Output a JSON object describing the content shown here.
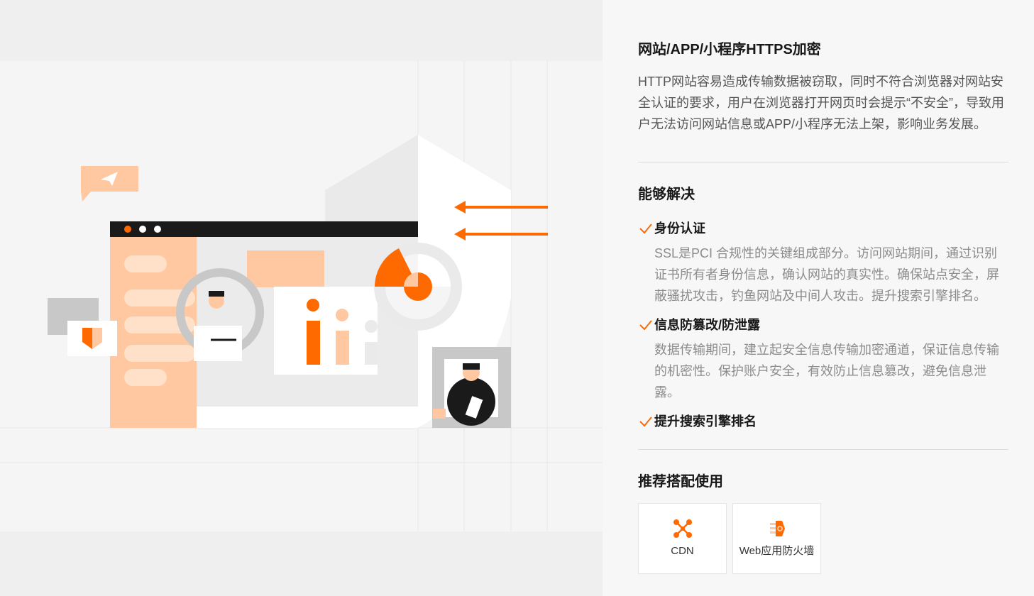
{
  "section": {
    "title": "网站/APP/小程序HTTPS加密",
    "description": "HTTP网站容易造成传输数据被窃取，同时不符合浏览器对网站安全认证的要求，用户在浏览器打开网页时会提示“不安全”，导致用户无法访问网站信息或APP/小程序无法上架，影响业务发展。"
  },
  "solve": {
    "title": "能够解决",
    "items": [
      {
        "title": "身份认证",
        "description": "SSL是PCI 合规性的关键组成部分。访问网站期间，通过识别证书所有者身份信息，确认网站的真实性。确保站点安全，屏蔽骚扰攻击，钓鱼网站及中间人攻击。提升搜索引擎排名。"
      },
      {
        "title": "信息防篡改/防泄露",
        "description": "数据传输期间，建立起安全信息传输加密通道，保证信息传输的机密性。保护账户安全，有效防止信息篡改，避免信息泄露。"
      },
      {
        "title": "提升搜索引擎排名",
        "description": ""
      }
    ]
  },
  "recommend": {
    "title": "推荐搭配使用",
    "cards": [
      {
        "label": "CDN",
        "icon": "cdn-icon"
      },
      {
        "label": "Web应用防火墙",
        "icon": "firewall-icon"
      }
    ]
  },
  "colors": {
    "accent": "#ff6a00",
    "peach": "#ffc8a0",
    "text_primary": "#181818",
    "text_secondary": "#555555",
    "text_muted": "#8c8c8c"
  }
}
